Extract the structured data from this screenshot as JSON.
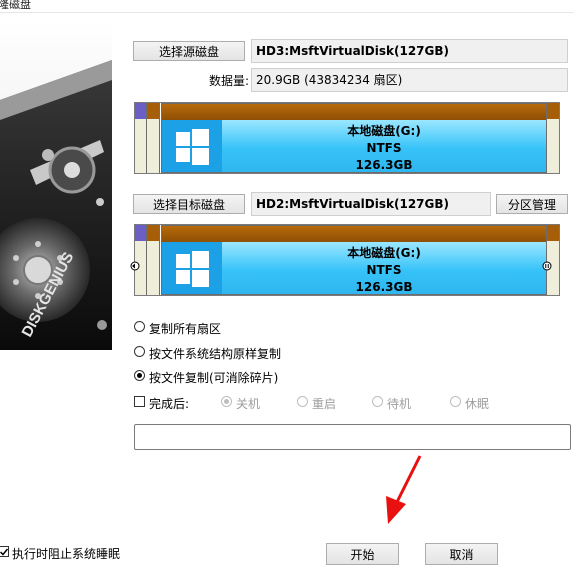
{
  "window": {
    "title": "隆磁盘"
  },
  "branding": {
    "logo_text": "DISKGENIUS"
  },
  "source": {
    "select_button": "选择源磁盘",
    "disk_name": "HD3:MsftVirtualDisk(127GB)",
    "data_size_label": "数据量:",
    "data_size_value": "20.9GB (43834234 扇区)",
    "partition": {
      "name": "本地磁盘(G:)",
      "fs": "NTFS",
      "size": "126.3GB"
    }
  },
  "target": {
    "select_button": "选择目标磁盘",
    "disk_name": "HD2:MsftVirtualDisk(127GB)",
    "partition_manage_button": "分区管理",
    "partition": {
      "name": "本地磁盘(G:)",
      "fs": "NTFS",
      "size": "126.3GB"
    }
  },
  "options": {
    "copy_all_sectors": "复制所有扇区",
    "copy_by_structure": "按文件系统结构原样复制",
    "copy_by_file": "按文件复制(可消除碎片)",
    "selected": "copy_by_file"
  },
  "after_complete": {
    "label": "完成后:",
    "checked": false,
    "choices": [
      "关机",
      "重启",
      "待机",
      "休眠"
    ],
    "selected": "关机"
  },
  "footer": {
    "prevent_sleep_label": "执行时阻止系统睡眠",
    "prevent_sleep_checked": true,
    "start_button": "开始",
    "cancel_button": "取消"
  },
  "colors": {
    "partition_header": "#a65e08",
    "partition_body": "#36c3f8",
    "annotation_arrow": "#e81010"
  }
}
